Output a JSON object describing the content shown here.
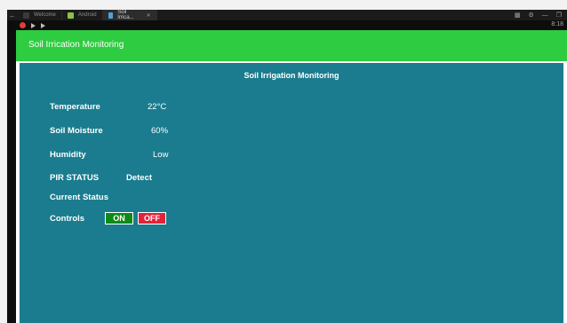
{
  "tabs": [
    {
      "label": "Welcome",
      "icon": "welcome-icon"
    },
    {
      "label": "Android",
      "icon": "android-icon"
    },
    {
      "label": "Soil Irrica...",
      "icon": "app-window-icon",
      "active": true
    }
  ],
  "status": {
    "time": "8:18"
  },
  "app": {
    "action_bar_title": "Soil Irrication Monitoring",
    "panel_title": "Soil Irrigation Monitoring",
    "readings": [
      {
        "label": "Temperature",
        "value": "22°C"
      },
      {
        "label": "Soil Moisture",
        "value": "60%"
      },
      {
        "label": "Humidity",
        "value": "Low"
      }
    ],
    "pir": {
      "label": "PIR STATUS",
      "value": "Detect"
    },
    "current_status": {
      "label": "Current Status",
      "value": ""
    },
    "controls": {
      "label": "Controls",
      "on_label": "ON",
      "off_label": "OFF"
    }
  },
  "colors": {
    "action_bar": "#2ecc40",
    "panel": "#1a7c8e",
    "on_button": "#0f8a17",
    "off_button": "#e0233a"
  }
}
